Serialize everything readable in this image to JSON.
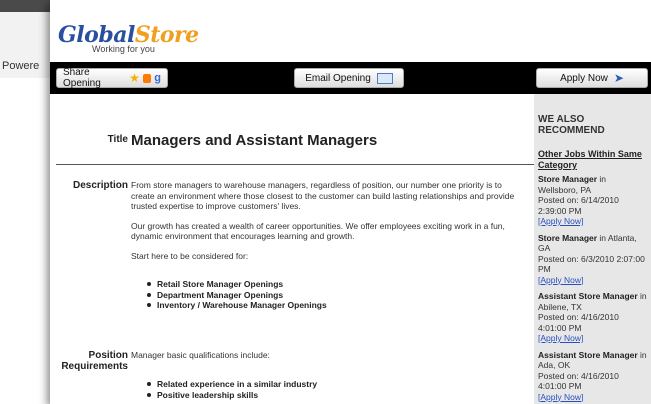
{
  "background": {
    "powered_text": "Powere"
  },
  "logo": {
    "main_part1": "Global",
    "main_part2": "Store",
    "tagline": "Working for you"
  },
  "toolbar": {
    "share_label": "Share Opening",
    "share_g": "g",
    "email_label": "Email Opening",
    "apply_label": "Apply Now"
  },
  "job": {
    "title_label": "Title",
    "title": "Managers and Assistant Managers",
    "description_label": "Description",
    "paragraphs": [
      "From store managers to warehouse managers, regardless of position, our number one priority is to create an environment where those closest to the customer can build lasting relationships and provide trusted expertise to improve customers' lives.",
      "Our growth has created a wealth of career opportunities. We offer employees exciting work in a fun, dynamic environment that encourages learning and growth.",
      "Start here to be considered for:"
    ],
    "openings": [
      "Retail Store Manager Openings",
      "Department Manager Openings",
      "Inventory / Warehouse Manager Openings"
    ],
    "position_label_line1": "Position",
    "position_label_line2": "Requirements",
    "requirements_intro": "Manager basic qualifications include:",
    "requirements": [
      "Related experience in a similar industry",
      "Positive leadership skills"
    ]
  },
  "sidebar": {
    "title": "WE ALSO RECOMMEND",
    "subtitle": "Other Jobs Within Same Category",
    "jobs": [
      {
        "role": "Store Manager",
        "location": " in Wellsboro, PA",
        "posted": "Posted on: 6/14/2010 2:39:00 PM",
        "apply": "[Apply Now]"
      },
      {
        "role": "Store Manager",
        "location": " in Atlanta, GA",
        "posted": "Posted on: 6/3/2010 2:07:00 PM",
        "apply": "[Apply Now]"
      },
      {
        "role": "Assistant Store Manager",
        "location": " in Abilene, TX",
        "posted": "Posted on: 4/16/2010 4:01:00 PM",
        "apply": "[Apply Now]"
      },
      {
        "role": "Assistant Store Manager",
        "location": " in Ada, OK",
        "posted": "Posted on: 4/16/2010 4:01:00 PM",
        "apply": "[Apply Now]"
      }
    ]
  }
}
